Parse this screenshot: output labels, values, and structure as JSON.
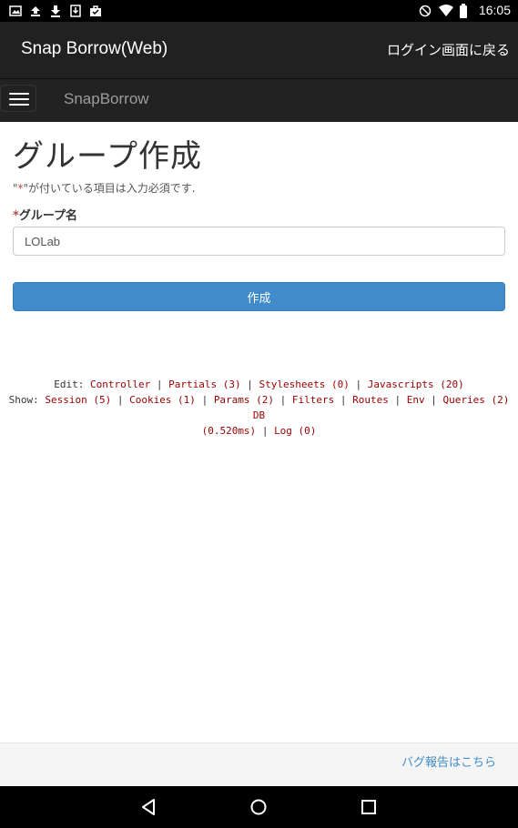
{
  "status_bar": {
    "time": "16:05",
    "left_icons": [
      "image-icon",
      "upload-icon",
      "download-icon",
      "download-box-icon",
      "bag-icon"
    ],
    "right_icons": [
      "do-not-disturb-icon",
      "wifi-icon",
      "battery-icon"
    ]
  },
  "app_header": {
    "title": "Snap Borrow(Web)",
    "back_link": "ログイン画面に戻る"
  },
  "navbar": {
    "brand": "SnapBorrow",
    "menu_icon": "hamburger-icon"
  },
  "form": {
    "title": "グループ作成",
    "required_note_prefix": "\"",
    "required_star": "*",
    "required_note_suffix": "\"が付いている項目は入力必須です.",
    "group_name_label": "グループ名",
    "group_name_value": "LOLab",
    "submit_label": "作成"
  },
  "debug": {
    "edit_label": "Edit:",
    "edit_links": [
      "Controller",
      "Partials (3)",
      "Stylesheets (0)",
      "Javascripts (20)"
    ],
    "show_label": "Show:",
    "show_links_line1": [
      "Session (5)",
      "Cookies (1)",
      "Params (2)",
      "Filters",
      "Routes",
      "Env",
      "Queries (2) DB"
    ],
    "show_links_line2": [
      "(0.520ms)",
      "Log (0)"
    ]
  },
  "footer": {
    "bug_report": "バグ報告はこちら"
  },
  "android_nav": {
    "back": "back-icon",
    "home": "home-icon",
    "recents": "recents-icon"
  },
  "colors": {
    "header_bg": "#212121",
    "navbar_bg": "#222222",
    "primary": "#428bca",
    "debug_link": "#990000",
    "required": "#b94a48"
  }
}
